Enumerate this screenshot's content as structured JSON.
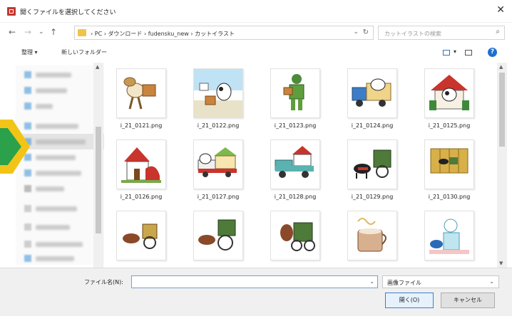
{
  "window": {
    "title": "開くファイルを選択してください",
    "close_glyph": "✕"
  },
  "nav": {
    "back": "←",
    "forward": "→",
    "recent": "⌄",
    "up": "↑"
  },
  "address": {
    "crumbs": "›  PC  ›  ダウンロード  ›  fudensku_new  ›  カットイラスト",
    "dropdown": "⌄",
    "refresh": "↻"
  },
  "search": {
    "placeholder": "カットイラストの検索",
    "icon": "⌕"
  },
  "toolbar": {
    "organize": "整理 ▾",
    "new_folder": "新しいフォルダー",
    "view_dropdown": "▾",
    "help": "?"
  },
  "files": [
    {
      "name": "i_21_0121.png",
      "icon": "cow-carrying-box"
    },
    {
      "name": "i_21_0122.png",
      "icon": "cow-delivery-man"
    },
    {
      "name": "i_21_0123.png",
      "icon": "cow-green-delivery"
    },
    {
      "name": "i_21_0124.png",
      "icon": "cow-truck-blue"
    },
    {
      "name": "i_21_0125.png",
      "icon": "cow-house-red"
    },
    {
      "name": "i_21_0126.png",
      "icon": "house-red-roof"
    },
    {
      "name": "i_21_0127.png",
      "icon": "cow-truck-house"
    },
    {
      "name": "i_21_0128.png",
      "icon": "truck-teal-house"
    },
    {
      "name": "i_21_0129.png",
      "icon": "ox-cart-green"
    },
    {
      "name": "i_21_0130.png",
      "icon": "ox-cart-golden-screen"
    },
    {
      "name": "",
      "icon": "ox-cart-small"
    },
    {
      "name": "",
      "icon": "ox-cart-wheel"
    },
    {
      "name": "",
      "icon": "ox-cart-front"
    },
    {
      "name": "",
      "icon": "coffee-cup"
    },
    {
      "name": "",
      "icon": "person-with-cow"
    }
  ],
  "bottom": {
    "filename_label": "ファイル名(N):",
    "filename_value": "",
    "filename_dropdown": "⌄",
    "filetype": "画像ファイル",
    "filetype_dropdown": "⌄",
    "open_button": "開く(O)",
    "cancel_button": "キャンセル"
  },
  "colors": {
    "accent": "#1e6fd0",
    "arrow_yellow": "#f2c418",
    "arrow_green": "#2aa14a",
    "folder": "#f1c34b"
  }
}
